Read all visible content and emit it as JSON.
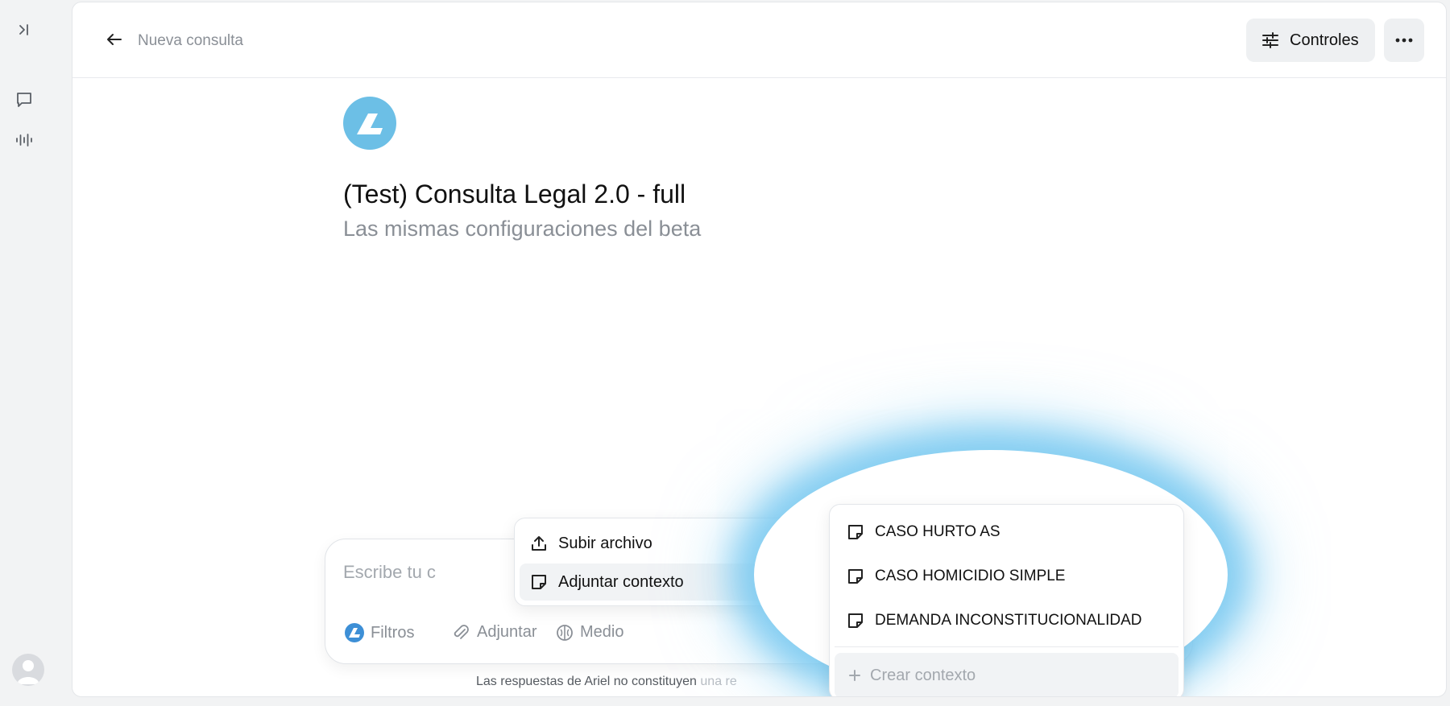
{
  "sidebar": {
    "expand_icon": "sidebar-expand-icon",
    "chat_icon": "chat-bubble-icon",
    "voice_icon": "audio-waveform-icon",
    "avatar_icon": "user-avatar-icon"
  },
  "header": {
    "breadcrumb": "Nueva consulta",
    "controls_label": "Controles",
    "more_icon": "ellipsis-icon"
  },
  "intro": {
    "title": "(Test) Consulta Legal 2.0 - full",
    "subtitle": "Las mismas configuraciones del beta"
  },
  "composer": {
    "placeholder": "Escribe tu c",
    "filters_label": "Filtros",
    "attach_label": "Adjuntar",
    "mode_label": "Medio"
  },
  "disclaimer": {
    "visible": "Las respuestas de Ariel no constituyen ",
    "faded": "una re"
  },
  "attach_menu": {
    "items": [
      {
        "label": "Subir archivo",
        "icon": "upload-icon"
      },
      {
        "label": "Adjuntar contexto",
        "icon": "note-icon"
      }
    ]
  },
  "context_menu": {
    "items": [
      {
        "label": "CASO HURTO AS"
      },
      {
        "label": "CASO HOMICIDIO SIMPLE"
      },
      {
        "label": "DEMANDA INCONSTITUCIONALIDAD"
      }
    ],
    "create_label": "Crear contexto"
  },
  "colors": {
    "brand": "#6cbfe6",
    "highlight_glow": "#78c8f0"
  }
}
